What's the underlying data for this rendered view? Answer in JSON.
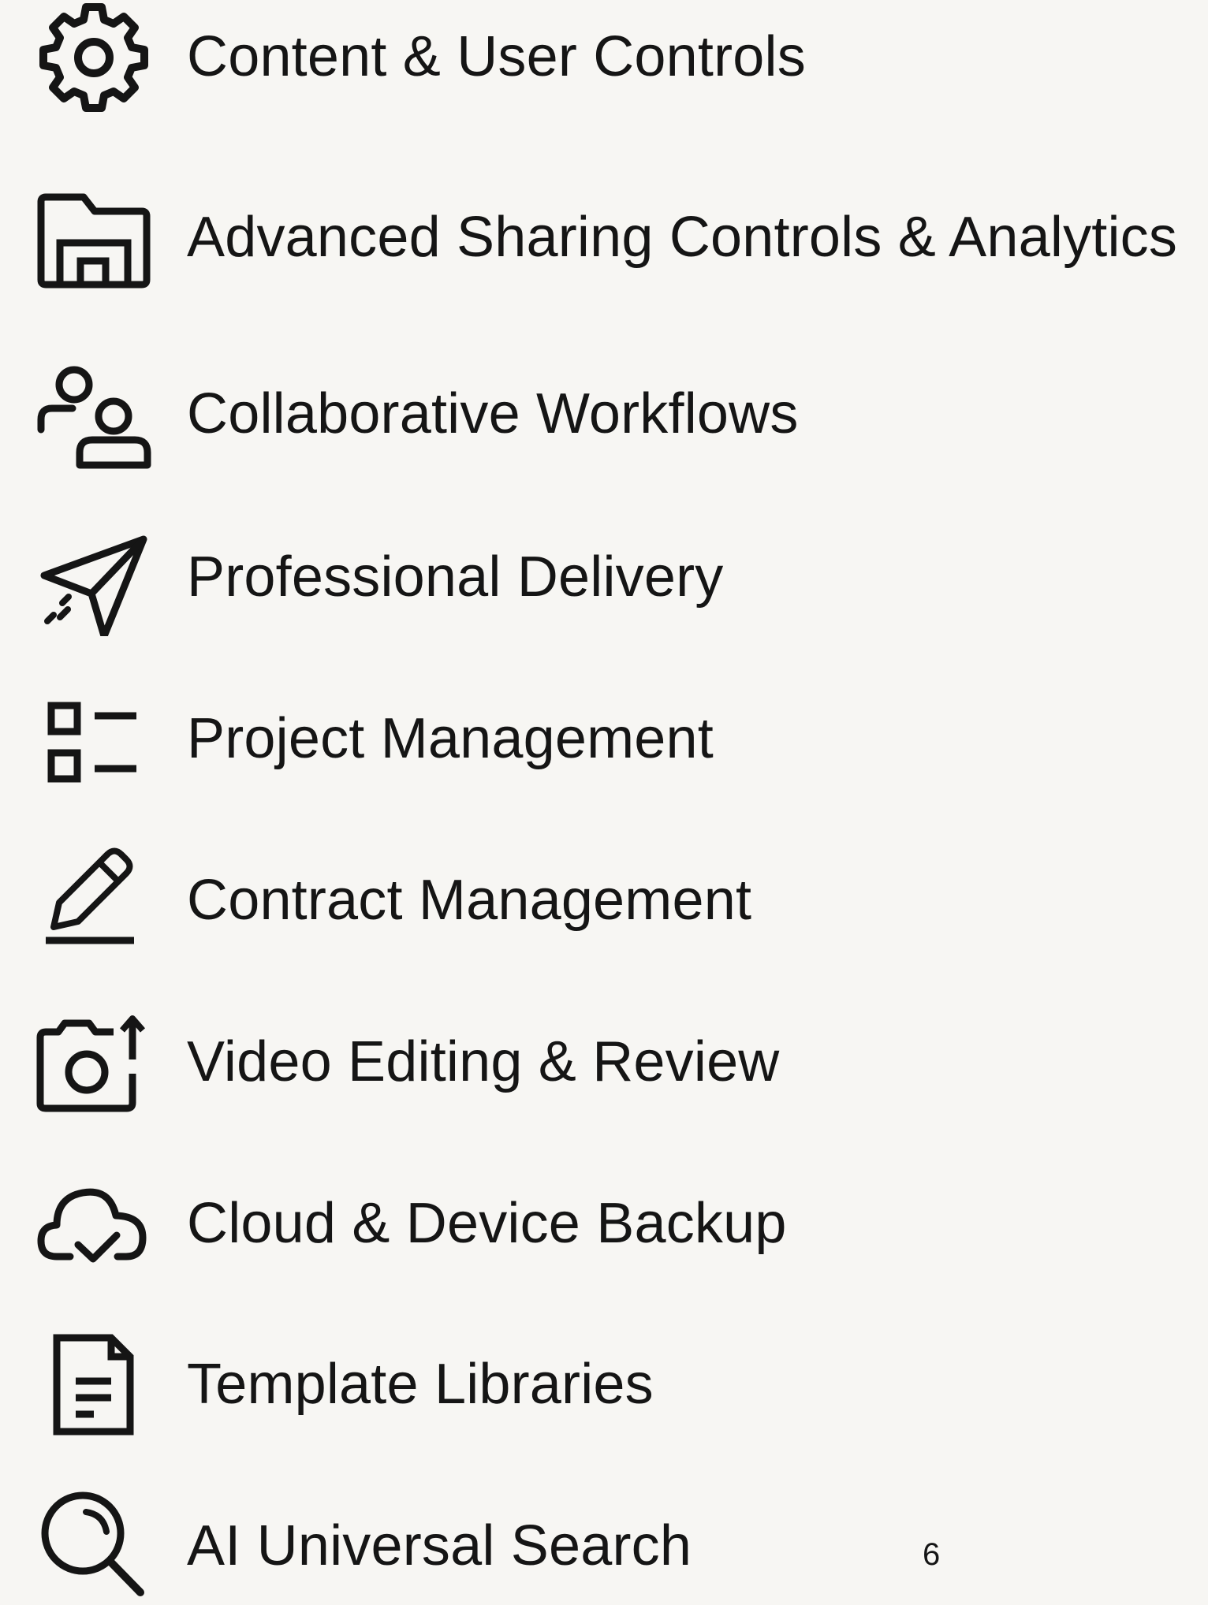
{
  "features": [
    {
      "icon": "gear-icon",
      "label": "Content & User Controls"
    },
    {
      "icon": "folder-icon",
      "label": "Advanced Sharing Controls & Analytics"
    },
    {
      "icon": "users-icon",
      "label": "Collaborative Workflows"
    },
    {
      "icon": "send-icon",
      "label": "Professional Delivery"
    },
    {
      "icon": "checklist-icon",
      "label": "Project Management"
    },
    {
      "icon": "pencil-icon",
      "label": "Contract Management"
    },
    {
      "icon": "camera-upload-icon",
      "label": "Video Editing & Review"
    },
    {
      "icon": "cloud-check-icon",
      "label": "Cloud & Device Backup"
    },
    {
      "icon": "document-icon",
      "label": "Template Libraries"
    },
    {
      "icon": "search-icon",
      "label": "AI Universal Search"
    }
  ],
  "page_number": "6",
  "colors": {
    "background": "#f7f6f3",
    "text": "#151515"
  }
}
